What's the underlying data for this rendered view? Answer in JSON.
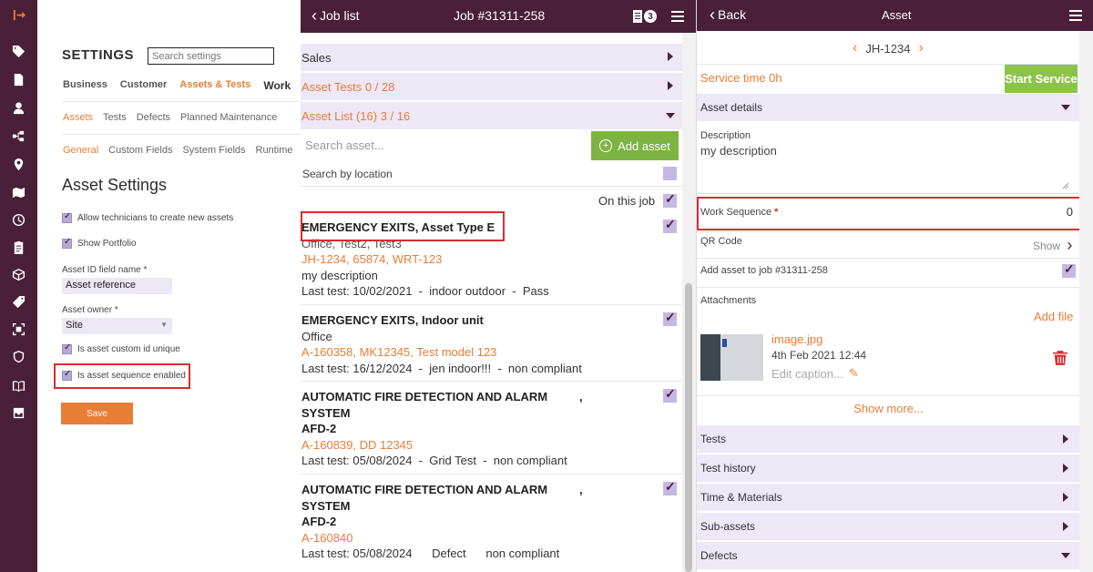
{
  "nav": {
    "icons": [
      "logout-icon",
      "tag-icon",
      "document-icon",
      "user-icon",
      "hierarchy-icon",
      "location-pin-icon",
      "map-icon",
      "clock-icon",
      "clipboard-icon",
      "cube-icon",
      "price-tag-icon",
      "scan-icon",
      "shield-icon",
      "book-icon",
      "inbox-icon"
    ]
  },
  "settings": {
    "title": "SETTINGS",
    "search_placeholder": "Search settings",
    "tabs": [
      "Business",
      "Customer",
      "Assets & Tests",
      "Work",
      "I"
    ],
    "active_tab": "Assets & Tests",
    "subtabs": [
      "Assets",
      "Tests",
      "Defects",
      "Planned Maintenance"
    ],
    "subtabs2": [
      "General",
      "Custom Fields",
      "System Fields",
      "Runtime"
    ],
    "heading": "Asset Settings",
    "opt_allow_create": "Allow technicians to create new assets",
    "opt_show_portfolio": "Show Portfolio",
    "asset_id_label": "Asset ID field name *",
    "asset_id_value": "Asset reference",
    "asset_owner_label": "Asset owner *",
    "asset_owner_value": "Site",
    "opt_custom_id": "Is asset custom id unique",
    "opt_sequence": "Is asset sequence enabled",
    "save": "Save"
  },
  "joblist": {
    "back": "Job list",
    "title": "Job #31311-258",
    "badge": "3",
    "sections": {
      "sales": "Sales",
      "asset_tests": "Asset Tests 0 / 28",
      "asset_list": "Asset List (16) 3 / 16"
    },
    "search_placeholder": "Search asset...",
    "add_asset": "Add asset",
    "search_by_location": "Search by location",
    "on_this_job": "On this job",
    "items": [
      {
        "name": "EMERGENCY EXITS, Asset Type E",
        "location": "Office, Test2, Test3",
        "refs": "JH-1234, 65874, WRT-123",
        "desc": "my description",
        "last_test": "Last test: 10/02/2021  -  indoor outdoor  -  Pass"
      },
      {
        "name": "EMERGENCY EXITS, Indoor unit",
        "location": "Office",
        "refs": "A-160358, MK12345, Test model 123",
        "last_test": "Last test: 16/12/2024  -  jen indoor!!!  -  non compliant"
      },
      {
        "name": "AUTOMATIC FIRE DETECTION AND ALARM SYSTEM",
        "comma": ",",
        "code": "AFD-2",
        "refs": "A-160839, DD 12345",
        "last_test": "Last test: 05/08/2024  -  Grid Test  -  non compliant"
      },
      {
        "name": "AUTOMATIC FIRE DETECTION AND ALARM SYSTEM",
        "comma": ",",
        "code": "AFD-2",
        "refs": "A-160840",
        "last_test": "Last test: 05/08/2024      Defect      non compliant"
      }
    ]
  },
  "asset": {
    "back": "Back",
    "title": "Asset",
    "asset_ref": "JH-1234",
    "service_time": "Service time 0h",
    "start_service": "Start Service",
    "details_section": "Asset details",
    "description_label": "Description",
    "description_value": "my description",
    "work_sequence_label": "Work Sequence",
    "required_mark": "*",
    "work_sequence_value": "0",
    "qr_label": "QR Code",
    "qr_show": "Show",
    "add_to_job": "Add asset to job #31311-258",
    "attachments": "Attachments",
    "add_file": "Add file",
    "file_name": "image.jpg",
    "file_date": "4th Feb 2021 12:44",
    "file_caption": "Edit caption...",
    "show_more": "Show more...",
    "sections": [
      "Tests",
      "Test history",
      "Time & Materials",
      "Sub-assets",
      "Defects"
    ]
  },
  "colors": {
    "nav_bg": "#4a1f38",
    "accent_orange": "#e87d35",
    "green": "#7cb342",
    "section_bg": "#ede7f6",
    "highlight_red": "#d32f2f"
  }
}
